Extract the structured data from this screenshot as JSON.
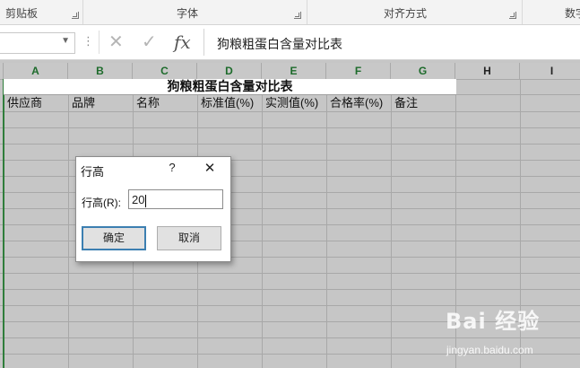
{
  "ribbon": {
    "groups": [
      {
        "label": "剪贴板"
      },
      {
        "label": "字体"
      },
      {
        "label": "对齐方式"
      },
      {
        "label": "数字"
      }
    ]
  },
  "formula_bar": {
    "cancel_icon": "close-icon",
    "enter_icon": "checkmark-icon",
    "fx_label": "fx",
    "formula": "狗粮粗蛋白含量对比表"
  },
  "columns": [
    "A",
    "B",
    "C",
    "D",
    "E",
    "F",
    "G",
    "H",
    "I"
  ],
  "sheet": {
    "title": "狗粮粗蛋白含量对比表",
    "headers": [
      "供应商",
      "品牌",
      "名称",
      "标准值(%)",
      "实测值(%)",
      "合格率(%)",
      "备注"
    ]
  },
  "dialog": {
    "title": "行高",
    "help": "?",
    "close": "✕",
    "label": "行高(R):",
    "value": "20",
    "ok": "确定",
    "cancel": "取消"
  },
  "watermark": {
    "brand": "Bai 经验",
    "url": "jingyan.baidu.com"
  },
  "colors": {
    "selection_fill": "#c6c6c6",
    "selection_border": "#2f7d3b",
    "default_button_border": "#3c7fb1"
  }
}
